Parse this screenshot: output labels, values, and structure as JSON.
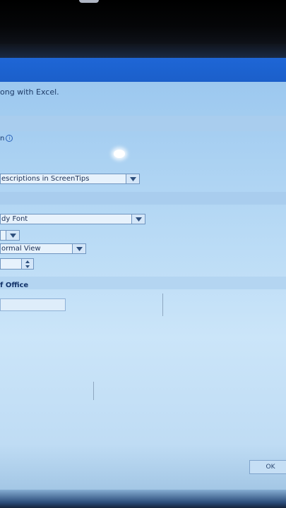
{
  "dialog": {
    "intro_text": "ong with Excel.",
    "section_label_1": "n",
    "screentips_select": "escriptions in ScreenTips",
    "font_select": "dy Font",
    "view_select": "ormal View",
    "office_section_label": "f Office",
    "ok_button": "OK"
  },
  "icons": {
    "info": "info-icon",
    "dropdown": "chevron-down-icon",
    "spinner": "spin-updown-icon"
  },
  "colors": {
    "titlebar": "#1e66d6",
    "dialog_bg": "#bfdcf4",
    "field_border": "#6f94bf"
  }
}
